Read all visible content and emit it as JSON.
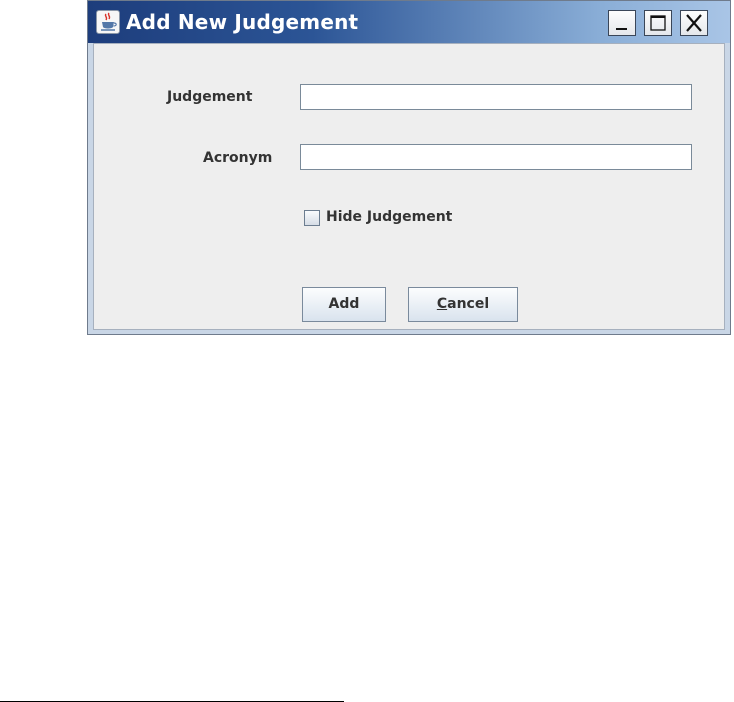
{
  "window": {
    "title": "Add New Judgement",
    "icon": "java-cup-icon",
    "controls": [
      "minimize-icon",
      "maximize-icon",
      "close-icon"
    ]
  },
  "form": {
    "judgement_label": "Judgement",
    "judgement_value": "",
    "acronym_label": "Acronym",
    "acronym_value": "",
    "hide_label": "Hide Judgement",
    "hide_checked": false
  },
  "buttons": {
    "add_label": "Add",
    "cancel_label": "Cancel"
  },
  "colors": {
    "title_gradient_start": "#1d3d7c",
    "title_gradient_end": "#a9c5e6",
    "client_background": "#eeeeee"
  }
}
